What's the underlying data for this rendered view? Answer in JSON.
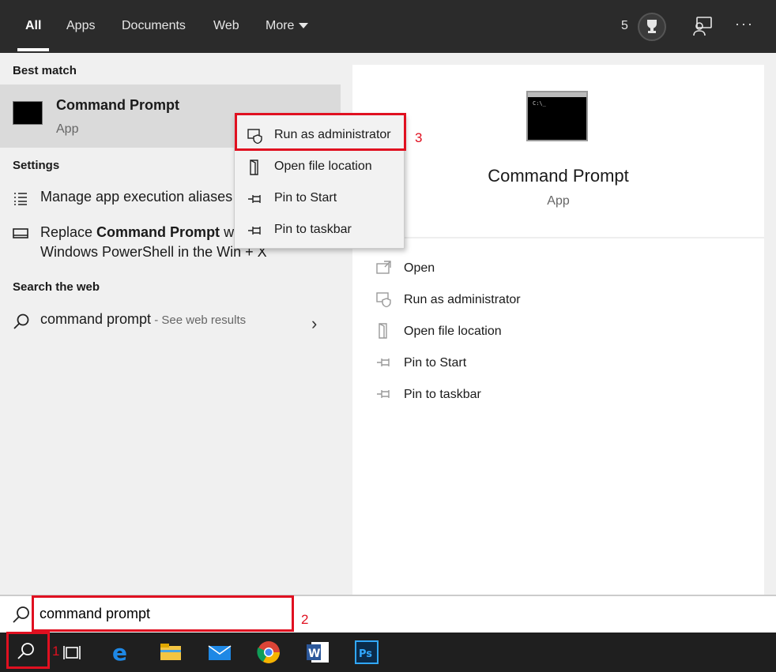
{
  "tabs": [
    {
      "label": "All",
      "active": true
    },
    {
      "label": "Apps"
    },
    {
      "label": "Documents"
    },
    {
      "label": "Web"
    },
    {
      "label": "More"
    }
  ],
  "header": {
    "points": "5",
    "more_options": "···"
  },
  "left": {
    "best_match_heading": "Best match",
    "best_match": {
      "title": "Command Prompt",
      "subtitle": "App"
    },
    "settings_heading": "Settings",
    "settings_items": [
      {
        "label": "Manage app execution aliases"
      },
      {
        "label_pre": "Replace ",
        "label_bold": "Command Prompt",
        "label_post": " with",
        "label_line2": "Windows PowerShell in the Win + X"
      }
    ],
    "web_heading": "Search the web",
    "web_item": {
      "label": "command prompt",
      "suffix": " - See web results"
    }
  },
  "right": {
    "title": "Command Prompt",
    "subtitle": "App",
    "actions": [
      {
        "label": "Open",
        "icon": "open-icon"
      },
      {
        "label": "Run as administrator",
        "icon": "shield-icon"
      },
      {
        "label": "Open file location",
        "icon": "folder-icon"
      },
      {
        "label": "Pin to Start",
        "icon": "pin-icon"
      },
      {
        "label": "Pin to taskbar",
        "icon": "pin-icon"
      }
    ]
  },
  "context_menu": {
    "items": [
      {
        "label": "Run as administrator",
        "icon": "shield-icon"
      },
      {
        "label": "Open file location",
        "icon": "folder-icon"
      },
      {
        "label": "Pin to Start",
        "icon": "pin-icon"
      },
      {
        "label": "Pin to taskbar",
        "icon": "pin-icon"
      }
    ]
  },
  "search": {
    "value": "command prompt"
  },
  "annotations": {
    "step1": "1",
    "step2": "2",
    "step3": "3",
    "color": "#e01020"
  },
  "taskbar": {
    "items": [
      "search-icon",
      "task-view-icon",
      "edge-icon",
      "file-explorer-icon",
      "mail-icon",
      "chrome-icon",
      "word-icon",
      "photoshop-icon"
    ]
  }
}
